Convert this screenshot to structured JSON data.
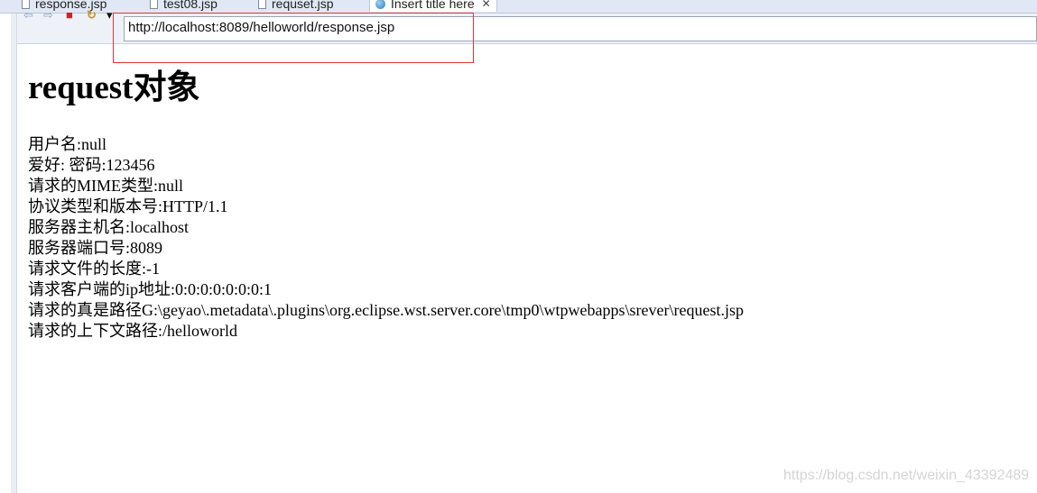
{
  "tabs": [
    {
      "label": "response.jsp"
    },
    {
      "label": "test08.jsp"
    },
    {
      "label": "requset.jsp"
    },
    {
      "label": "Insert title here"
    }
  ],
  "toolbar": {
    "back_glyph": "⇦",
    "forward_glyph": "⇨",
    "stop_glyph": "■",
    "refresh_glyph": "↻",
    "menu_glyph": "▾",
    "url": "http://localhost:8089/helloworld/response.jsp"
  },
  "page": {
    "heading": "request对象",
    "lines": [
      "用户名:null",
      "爱好: 密码:123456",
      "请求的MIME类型:null",
      "协议类型和版本号:HTTP/1.1",
      "服务器主机名:localhost",
      "服务器端口号:8089",
      "请求文件的长度:-1",
      "请求客户端的ip地址:0:0:0:0:0:0:0:1",
      "请求的真是路径G:\\geyao\\.metadata\\.plugins\\org.eclipse.wst.server.core\\tmp0\\wtpwebapps\\srever\\request.jsp",
      "请求的上下文路径:/helloworld"
    ]
  },
  "watermark": "https://blog.csdn.net/weixin_43392489",
  "colors": {
    "highlight": "#e0323a",
    "stop": "#d0202a"
  }
}
